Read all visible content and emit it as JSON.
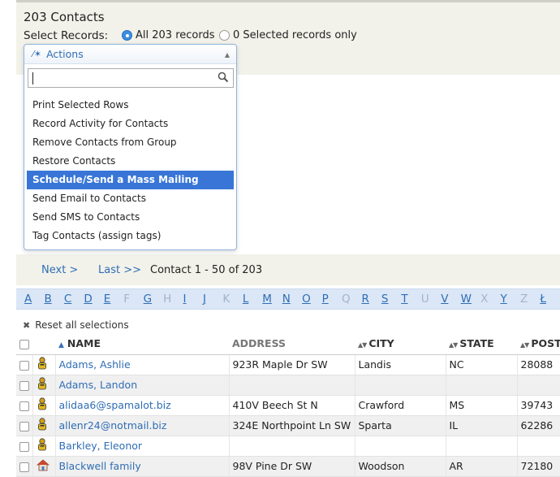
{
  "header": {
    "title": "203 Contacts",
    "select_label": "Select Records:",
    "radio_all": "All 203 records",
    "radio_selected": "0 Selected records only"
  },
  "actions": {
    "label": "Actions",
    "search_value": "",
    "items": [
      "Print Selected Rows",
      "Record Activity for Contacts",
      "Remove Contacts from Group",
      "Restore Contacts",
      "Schedule/Send a Mass Mailing",
      "Send Email to Contacts",
      "Send SMS to Contacts",
      "Tag Contacts (assign tags)"
    ],
    "highlighted_index": 4
  },
  "pager": {
    "next": "Next >",
    "last": "Last >>",
    "info": "Contact 1 - 50 of 203"
  },
  "alphabet": [
    {
      "l": "A",
      "on": true
    },
    {
      "l": "B",
      "on": true
    },
    {
      "l": "C",
      "on": true
    },
    {
      "l": "D",
      "on": true
    },
    {
      "l": "E",
      "on": true
    },
    {
      "l": "F",
      "on": false
    },
    {
      "l": "G",
      "on": true
    },
    {
      "l": "H",
      "on": false
    },
    {
      "l": "I",
      "on": true
    },
    {
      "l": "J",
      "on": true
    },
    {
      "l": "K",
      "on": false
    },
    {
      "l": "L",
      "on": true
    },
    {
      "l": "M",
      "on": true
    },
    {
      "l": "N",
      "on": true
    },
    {
      "l": "O",
      "on": true
    },
    {
      "l": "P",
      "on": true
    },
    {
      "l": "Q",
      "on": false
    },
    {
      "l": "R",
      "on": true
    },
    {
      "l": "S",
      "on": true
    },
    {
      "l": "T",
      "on": true
    },
    {
      "l": "U",
      "on": false
    },
    {
      "l": "V",
      "on": true
    },
    {
      "l": "W",
      "on": true
    },
    {
      "l": "X",
      "on": false
    },
    {
      "l": "Y",
      "on": true
    },
    {
      "l": "Z",
      "on": false
    },
    {
      "l": "Ł",
      "on": true
    }
  ],
  "reset_label": "Reset all selections",
  "table": {
    "columns": [
      "NAME",
      "ADDRESS",
      "CITY",
      "STATE",
      "POSTAL"
    ],
    "rows": [
      {
        "type": "person",
        "name": "Adams, Ashlie",
        "address": "923R Maple Dr SW",
        "city": "Landis",
        "state": "NC",
        "postal": "28088"
      },
      {
        "type": "person",
        "name": "Adams, Landon",
        "address": "",
        "city": "",
        "state": "",
        "postal": ""
      },
      {
        "type": "person",
        "name": "alidaa6@spamalot.biz",
        "address": "410V Beech St N",
        "city": "Crawford",
        "state": "MS",
        "postal": "39743"
      },
      {
        "type": "person",
        "name": "allenr24@notmail.biz",
        "address": "324E Northpoint Ln SW",
        "city": "Sparta",
        "state": "IL",
        "postal": "62286"
      },
      {
        "type": "person",
        "name": "Barkley, Eleonor",
        "address": "",
        "city": "",
        "state": "",
        "postal": ""
      },
      {
        "type": "household",
        "name": "Blackwell family",
        "address": "98V Pine Dr SW",
        "city": "Woodson",
        "state": "AR",
        "postal": "72180"
      }
    ]
  }
}
